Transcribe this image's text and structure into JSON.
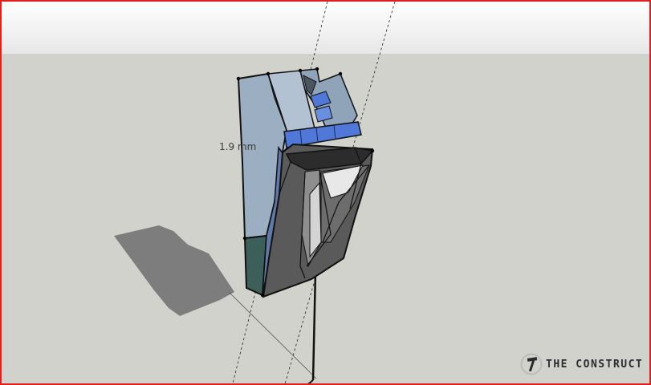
{
  "viewport": {
    "dimension_label": "1.9 mm",
    "logo_text": "THE CONSTRUCT",
    "colors": {
      "frame_border": "#e01f1f",
      "sky": "#f0f0f0",
      "ground": "#d2d2cc",
      "shadow": "#7e7e7e",
      "panel_light": "#93a6ba",
      "panel_blue": "#4f78d8",
      "panel_teal": "#3d5f5a",
      "panel_dark": "#4a4a4a"
    },
    "icons": [
      "hammer-logo-icon"
    ]
  }
}
